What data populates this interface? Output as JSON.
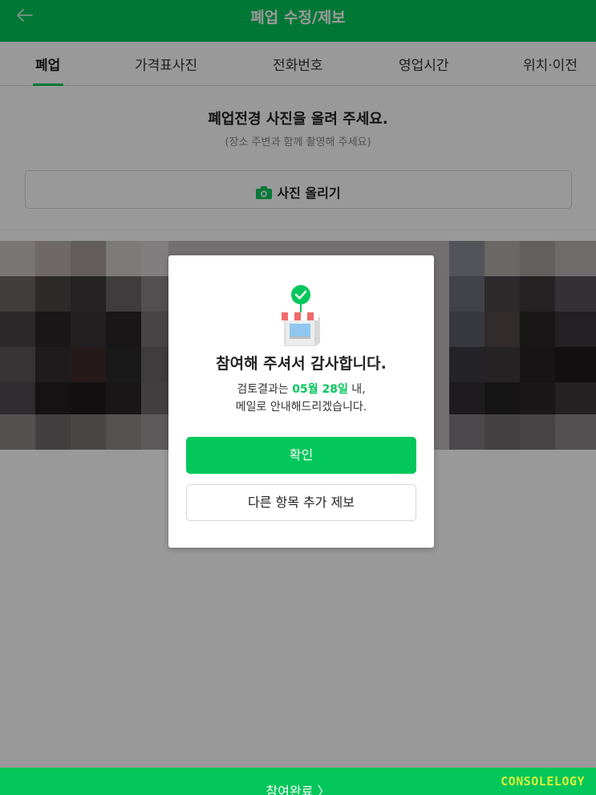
{
  "header": {
    "title": "폐업 수정/제보",
    "back_icon": "arrow-left-icon",
    "bg_color": "#03c75a"
  },
  "tabs": [
    {
      "label": "폐업",
      "active": true
    },
    {
      "label": "가격표사진",
      "active": false
    },
    {
      "label": "전화번호",
      "active": false
    },
    {
      "label": "영업시간",
      "active": false
    },
    {
      "label": "위치·이전",
      "active": false
    }
  ],
  "upload": {
    "title": "폐업전경 사진을 올려 주세요.",
    "subtitle": "(장소 주변과 함께 촬영해 주세요)",
    "button_label": "사진 올리기",
    "button_icon": "camera-icon"
  },
  "modal": {
    "icon": "store-check-icon",
    "title": "참여해 주셔서 감사합니다.",
    "message_prefix": "검토결과는",
    "message_date": "05월 28일",
    "message_suffix": "내,",
    "message_line2": "메일로 안내해드리겠습니다.",
    "confirm_label": "확인",
    "more_label": "다른 항목 추가 제보"
  },
  "bottom_bar": {
    "label": "참여완료 〉",
    "watermark": "CONSOLELOGY"
  },
  "colors": {
    "accent": "#03c75a",
    "watermark": "#d7f03a"
  }
}
